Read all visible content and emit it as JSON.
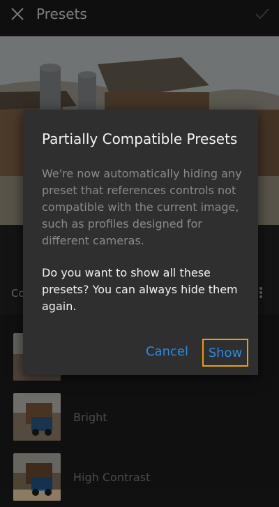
{
  "header": {
    "title": "Presets",
    "close_icon": "close-icon",
    "confirm_icon": "check-icon"
  },
  "category_bar": {
    "label": "Co",
    "menu_icon": "more-vertical-icon"
  },
  "presets": [
    {
      "label": ""
    },
    {
      "label": "Bright"
    },
    {
      "label": "High Contrast"
    }
  ],
  "dialog": {
    "title": "Partially Compatible Presets",
    "body": "We're now automatically hiding any preset that references controls not compatible with the current image, such as profiles designed for different cameras.",
    "question": "Do you want to show all these presets? You can always hide them again.",
    "cancel_label": "Cancel",
    "show_label": "Show"
  },
  "colors": {
    "accent_blue": "#2c8ae0",
    "focus_orange": "#e6a012",
    "dialog_bg": "#2f2f2f"
  }
}
